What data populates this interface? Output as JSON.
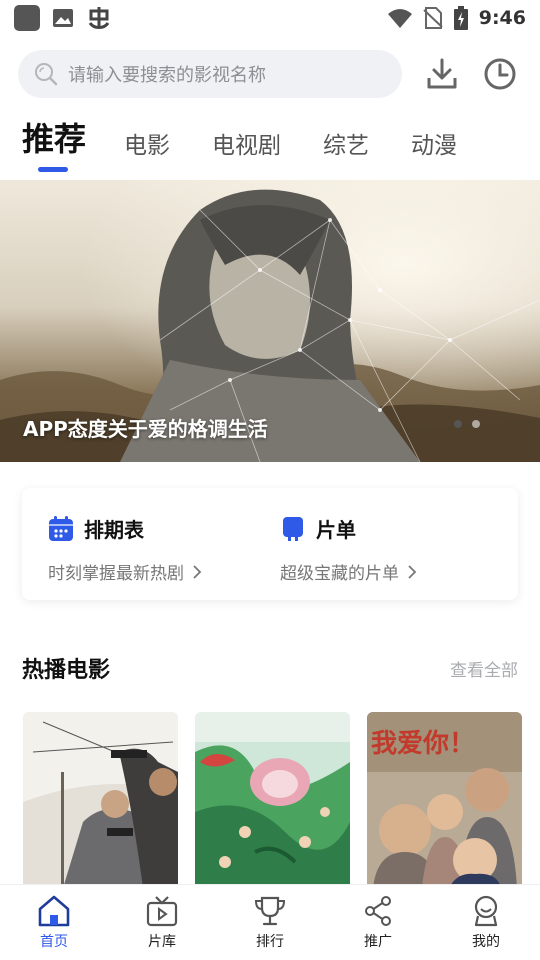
{
  "status_bar": {
    "time": "9:46",
    "icons": [
      "app-icon",
      "gallery-icon",
      "bug-app-icon",
      "wifi-icon",
      "no-sim-icon",
      "battery-icon"
    ]
  },
  "search": {
    "placeholder": "请输入要搜索的影视名称",
    "icons": [
      "search-icon",
      "download-icon",
      "history-icon"
    ]
  },
  "tabs": [
    {
      "label": "推荐",
      "active": true
    },
    {
      "label": "电影",
      "active": false
    },
    {
      "label": "电视剧",
      "active": false
    },
    {
      "label": "综艺",
      "active": false
    },
    {
      "label": "动漫",
      "active": false
    }
  ],
  "banner": {
    "title": "APP态度关于爱的格调生活",
    "slide_count": 2,
    "active_slide": 1
  },
  "features": [
    {
      "title": "排期表",
      "subtitle": "时刻掌握最新热剧",
      "icon": "calendar-icon"
    },
    {
      "title": "片单",
      "subtitle": "超级宝藏的片单",
      "icon": "playlist-icon"
    }
  ],
  "hot_movies": {
    "title": "热播电影",
    "see_all": "查看全部",
    "posters": [
      {
        "poster_text": ""
      },
      {
        "poster_text": ""
      },
      {
        "poster_text": "我爱你！"
      }
    ]
  },
  "bottom_nav": [
    {
      "label": "首页",
      "icon": "home-icon",
      "active": true
    },
    {
      "label": "片库",
      "icon": "tv-icon",
      "active": false
    },
    {
      "label": "排行",
      "icon": "trophy-icon",
      "active": false
    },
    {
      "label": "推广",
      "icon": "share-icon",
      "active": false
    },
    {
      "label": "我的",
      "icon": "profile-icon",
      "active": false
    }
  ],
  "colors": {
    "accent": "#2f5ae8",
    "search_bg": "#eff1f4",
    "muted_text": "#777777"
  }
}
